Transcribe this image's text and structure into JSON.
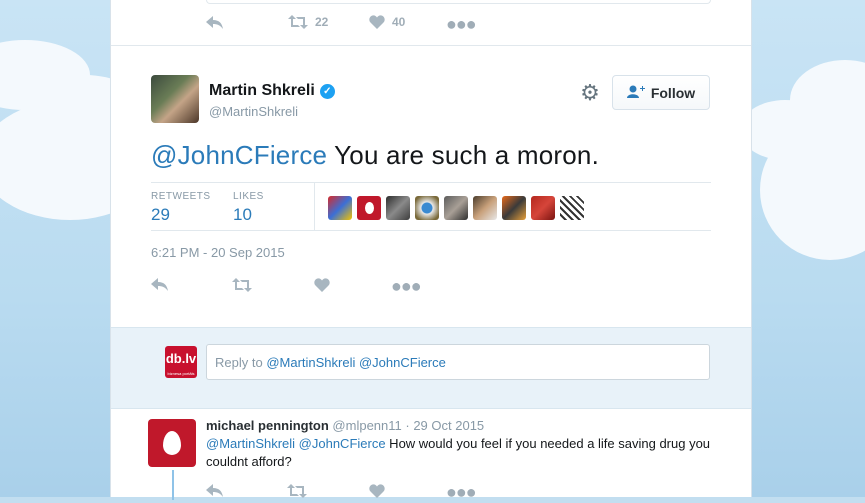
{
  "colors": {
    "accent": "#2b7bb9",
    "verified": "#1da1f2",
    "muted": "#8899a6"
  },
  "prev_tweet": {
    "retweet_count": "22",
    "like_count": "40"
  },
  "tweet": {
    "author_name": "Martin Shkreli",
    "verified_mark": "✓",
    "author_handle": "@MartinShkreli",
    "follow_label": "Follow",
    "mention": "@JohnCFierce",
    "body": " You are such a moron.",
    "retweets_label": "RETWEETS",
    "retweets_value": "29",
    "likes_label": "LIKES",
    "likes_value": "10",
    "timestamp": "6:21 PM - 20 Sep 2015",
    "liker_avatars": [
      "avatar-1",
      "avatar-2",
      "avatar-3",
      "avatar-4",
      "avatar-5",
      "avatar-6",
      "avatar-7",
      "avatar-8",
      "avatar-9"
    ]
  },
  "reply_box": {
    "logo_text": "db.lv",
    "logo_subtext": "biznesa portāls",
    "prefix": "Reply to ",
    "mentions": "@MartinShkreli @JohnCFierce"
  },
  "reply": {
    "author_name": "michael pennington",
    "author_handle": "@mlpenn11",
    "separator": " · ",
    "date": "29 Oct 2015",
    "mentions": "@MartinShkreli @JohnCFierce",
    "body": " How would you feel if you needed a life saving drug you couldnt afford?"
  }
}
